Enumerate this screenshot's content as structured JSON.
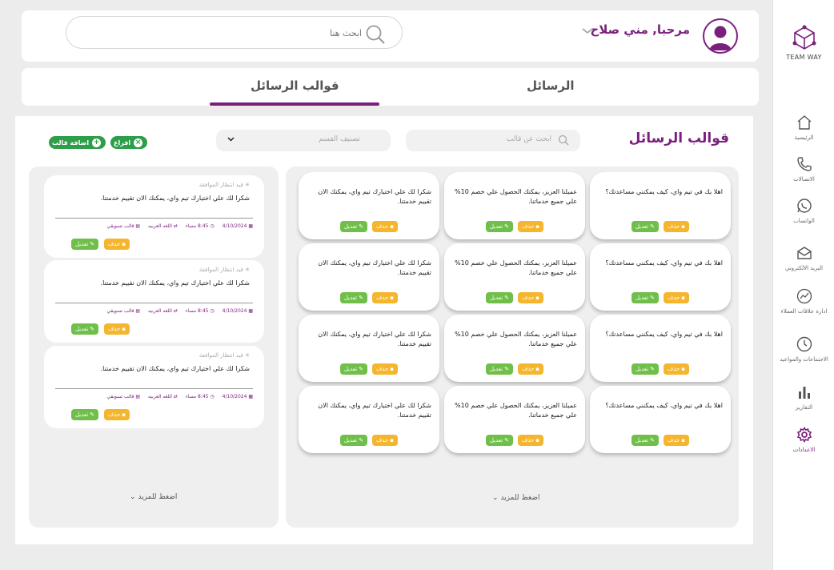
{
  "sidebar": {
    "brand": "TEAM WAY",
    "items": [
      {
        "label": "الرئيسية",
        "icon": "home-icon"
      },
      {
        "label": "الاتصالات",
        "icon": "phone-icon"
      },
      {
        "label": "الواتساب",
        "icon": "whatsapp-icon"
      },
      {
        "label": "البريد الالكتروني",
        "icon": "mail-icon"
      },
      {
        "label": "ادارة علاقات العملاء",
        "icon": "chart-line-icon"
      },
      {
        "label": "الاجتماعات والمواعيد",
        "icon": "clock-icon"
      },
      {
        "label": "التقارير",
        "icon": "bar-chart-icon"
      },
      {
        "label": "الاعدادات",
        "icon": "gear-icon"
      }
    ],
    "active_index": 7
  },
  "header": {
    "greeting": "مرحبا, مني صلاح",
    "search_placeholder": "ابحث هنا"
  },
  "tabs": {
    "messages": "الرسائل",
    "templates": "قوالب الرسائل",
    "active": "templates"
  },
  "main": {
    "title": "قوالب الرسائل",
    "template_search_placeholder": "ابحث عن قالب",
    "category_placeholder": "تصنيف القسم",
    "clear_button": "افراغ",
    "add_button": "اضافة قالب",
    "load_more": "اضغط للمزيد",
    "delete_label": "حذف",
    "edit_label": "تعديل"
  },
  "templates": [
    [
      "اهلا بك في تيم واي، كيف يمكنني مساعدتك؟",
      "عميلنا العزيز، يمكنك الحصول علي خصم 10% علي جميع خدماتنا.",
      "شكرا لك علي اختيارك تيم واي، يمكنك الان تقييم خدمتنا."
    ],
    [
      "اهلا بك في تيم واي، كيف يمكنني مساعدتك؟",
      "عميلنا العزيز، يمكنك الحصول علي خصم 10% علي جميع خدماتنا.",
      "شكرا لك علي اختيارك تيم واي، يمكنك الان تقييم خدمتنا."
    ],
    [
      "اهلا بك في تيم واي، كيف يمكنني مساعدتك؟",
      "عميلنا العزيز، يمكنك الحصول علي خصم 10% علي جميع خدماتنا.",
      "شكرا لك علي اختيارك تيم واي، يمكنك الان تقييم خدمتنا."
    ],
    [
      "اهلا بك في تيم واي، كيف يمكنني مساعدتك؟",
      "عميلنا العزيز، يمكنك الحصول علي خصم 10% علي جميع خدماتنا.",
      "شكرا لك علي اختيارك تيم واي، يمكنك الان تقييم خدمتنا."
    ]
  ],
  "pending": {
    "status": "قيد انتظار الموافقة",
    "items": [
      {
        "message": "شكرا لك علي اختيارك تيم واي، يمكنك الان تقييم خدمتنا.",
        "date": "4/10/2024",
        "time": "8:45 مساء",
        "language": "اللغه العربيه",
        "type": "قالب تسويقي"
      },
      {
        "message": "شكرا لك علي اختيارك تيم واي، يمكنك الان تقييم خدمتنا.",
        "date": "4/10/2024",
        "time": "8:45 مساء",
        "language": "اللغه العربيه",
        "type": "قالب تسويقي"
      },
      {
        "message": "شكرا لك علي اختيارك تيم واي، يمكنك الان تقييم خدمتنا.",
        "date": "4/10/2024",
        "time": "8:45 مساء",
        "language": "اللغه العربيه",
        "type": "قالب تسويقي"
      }
    ]
  },
  "colors": {
    "accent": "#7b1f7d",
    "green": "#2e9e4b",
    "edit": "#6fbf4a",
    "delete": "#f5b52d"
  }
}
